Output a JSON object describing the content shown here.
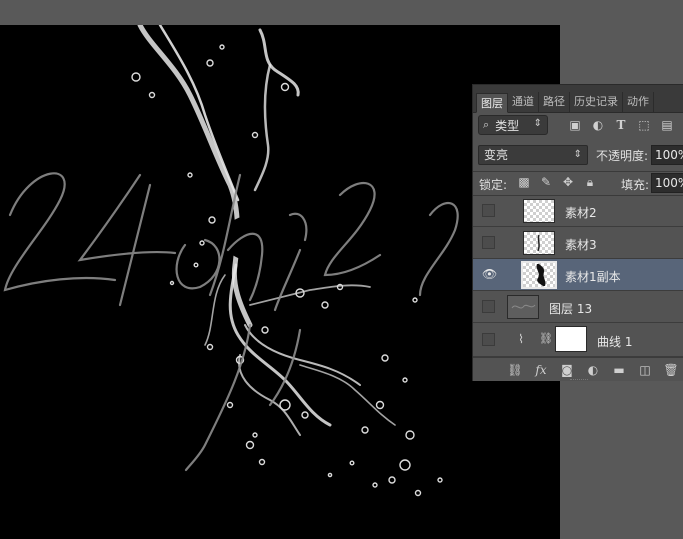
{
  "panel": {
    "tabs": [
      "图层",
      "通道",
      "路径",
      "历史记录",
      "动作"
    ],
    "filter_label": "类型",
    "filter_search_glyph": "⌕",
    "blend_mode": "变亮",
    "opacity_label": "不透明度:",
    "opacity_value": "100%",
    "lock_label": "锁定:",
    "fill_label": "填充:",
    "fill_value": "100%"
  },
  "layers": [
    {
      "name": "素材2",
      "visible": false,
      "selected": false
    },
    {
      "name": "素材3",
      "visible": false,
      "selected": false
    },
    {
      "name": "素材1副本",
      "visible": true,
      "selected": true
    },
    {
      "name": "图层 13",
      "visible": false,
      "selected": false
    },
    {
      "name": "曲线 1",
      "visible": false,
      "selected": false
    }
  ],
  "colors": {
    "canvas": "#000000",
    "workspace": "#595959",
    "panel": "#535353",
    "selected_layer": "#586579",
    "handwriting": "#8c8c8c"
  },
  "icons": [
    "search-icon",
    "image-filter-icon",
    "adjustment-filter-icon",
    "type-filter-icon",
    "shape-filter-icon",
    "smart-object-filter-icon",
    "lock-transparent-icon",
    "lock-paint-icon",
    "lock-move-icon",
    "lock-all-icon",
    "eye-icon",
    "link-icon",
    "fx-icon",
    "mask-icon",
    "adjustment-icon",
    "folder-icon",
    "new-layer-icon",
    "trash-icon",
    "curves-icon",
    "chain-icon"
  ]
}
